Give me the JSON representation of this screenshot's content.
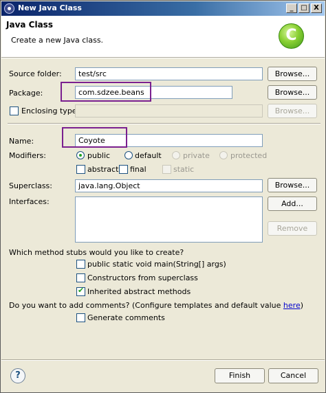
{
  "window": {
    "title": "New Java Class",
    "minimize": "_",
    "maximize": "□",
    "close": "X"
  },
  "header": {
    "title": "Java Class",
    "description": "Create a new Java class."
  },
  "form": {
    "source_folder": {
      "label": "Source folder:",
      "value": "test/src",
      "button": "Browse..."
    },
    "package": {
      "label": "Package:",
      "value": "com.sdzee.beans",
      "button": "Browse..."
    },
    "enclosing_type": {
      "label": "Enclosing type:",
      "value": "",
      "button": "Browse...",
      "checked": false
    },
    "name": {
      "label": "Name:",
      "value": "Coyote"
    },
    "modifiers": {
      "label": "Modifiers:",
      "public": "public",
      "default": "default",
      "private": "private",
      "protected": "protected",
      "abstract": "abstract",
      "final": "final",
      "static": "static",
      "selected": "public"
    },
    "superclass": {
      "label": "Superclass:",
      "value": "java.lang.Object",
      "button": "Browse..."
    },
    "interfaces": {
      "label": "Interfaces:",
      "add_button": "Add...",
      "remove_button": "Remove"
    }
  },
  "stubs": {
    "question": "Which method stubs would you like to create?",
    "options": [
      {
        "label": "public static void main(String[] args)",
        "checked": false
      },
      {
        "label": "Constructors from superclass",
        "checked": false
      },
      {
        "label": "Inherited abstract methods",
        "checked": true
      }
    ]
  },
  "comments": {
    "question": "Do you want to add comments? (Configure templates and default value ",
    "link": "here",
    "suffix": ")",
    "option": {
      "label": "Generate comments",
      "checked": false
    }
  },
  "footer": {
    "help": "?",
    "finish": "Finish",
    "cancel": "Cancel"
  },
  "colors": {
    "highlight": "#7a1f8f",
    "titlebar": "#0a246a",
    "check": "#21a121"
  }
}
